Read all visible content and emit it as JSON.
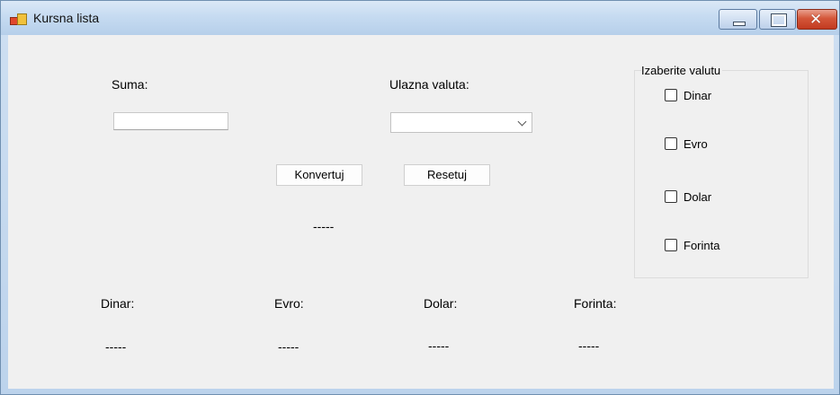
{
  "window": {
    "title": "Kursna lista"
  },
  "form": {
    "suma_label": "Suma:",
    "suma_value": "",
    "ulazna_label": "Ulazna valuta:",
    "ulazna_value": "",
    "convert_button": "Konvertuj",
    "reset_button": "Resetuj",
    "result": "-----"
  },
  "group": {
    "title": "Izaberite valutu",
    "options": [
      {
        "label": "Dinar",
        "checked": false
      },
      {
        "label": "Evro",
        "checked": false
      },
      {
        "label": "Dolar",
        "checked": false
      },
      {
        "label": "Forinta",
        "checked": false
      }
    ]
  },
  "outputs": [
    {
      "label": "Dinar:",
      "value": "-----"
    },
    {
      "label": "Evro:",
      "value": "-----"
    },
    {
      "label": "Dolar:",
      "value": "-----"
    },
    {
      "label": "Forinta:",
      "value": "-----"
    }
  ]
}
